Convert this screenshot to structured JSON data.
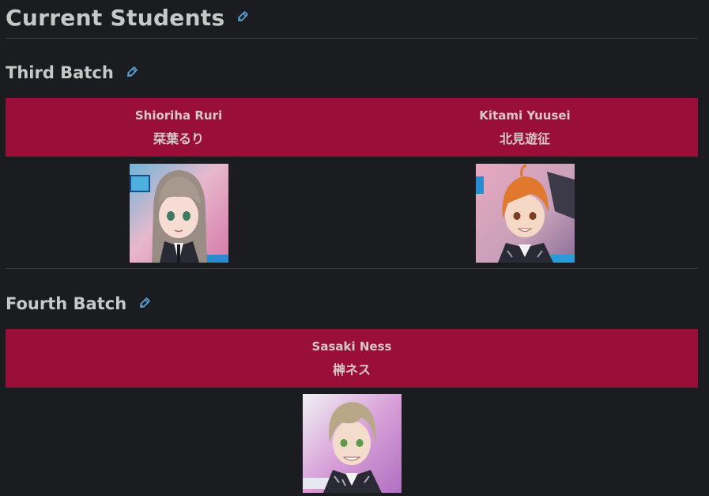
{
  "page_title": "Current Students",
  "edit_icon_color": "#5aa0d8",
  "banner_color": "#9a0e3a",
  "sections": [
    {
      "heading": "Third Batch",
      "students": [
        {
          "name_en": "Shioriha Ruri",
          "name_jp": "栞葉るり",
          "icon": "avatar-shioriha-ruri"
        },
        {
          "name_en": "Kitami Yuusei",
          "name_jp": "北見遊征",
          "icon": "avatar-kitami-yuusei"
        }
      ]
    },
    {
      "heading": "Fourth Batch",
      "students": [
        {
          "name_en": "Sasaki Ness",
          "name_jp": "榊ネス",
          "icon": "avatar-sasaki-ness"
        }
      ]
    }
  ]
}
